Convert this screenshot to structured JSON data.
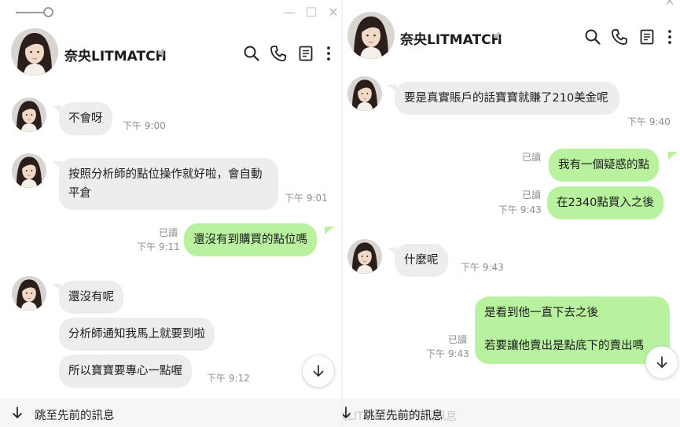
{
  "left": {
    "contact_name": "奈央LITMATCH",
    "messages": [
      {
        "text": "不會呀",
        "time": "下午 9:00"
      },
      {
        "text": "按照分析師的點位操作就好啦，會自動平倉",
        "time": "下午 9:01"
      },
      {
        "text": "還沒有到購買的點位嗎",
        "read": "已讀",
        "time": "下午 9:11"
      },
      {
        "text": "還沒有呢"
      },
      {
        "text": "分析師通知我馬上就要到啦"
      },
      {
        "text": "所以寶寶要專心一點喔",
        "time": "下午 9:12"
      }
    ],
    "jump_label": "跳至先前的訊息"
  },
  "right": {
    "contact_name": "奈央LITMATCH",
    "messages": [
      {
        "text": "要是真實賬戶的話寶寶就賺了210美金呢",
        "time": "下午 9:40"
      },
      {
        "text": "我有一個疑惑的點",
        "read": "已讀"
      },
      {
        "text": "在2340點買入之後",
        "read": "已讀",
        "time": "下午 9:43"
      },
      {
        "text": "什麼呢",
        "time": "下午 9:43"
      },
      {
        "line1": "是看到他一直下去之後",
        "line2": "若要讓他賣出是點底下的賣出嗎",
        "read": "已讀",
        "time": "下午 9:43"
      }
    ],
    "jump_label": "跳至先前的訊息",
    "ghost_text": "央LITMATCH已收回訊息"
  },
  "icons": {
    "search": "search-icon",
    "call": "phone-icon",
    "notes": "notes-icon",
    "more": "more-vertical-icon",
    "mute": "speaker-muted-icon",
    "scroll_down": "arrow-down-icon",
    "jump": "arrow-down-icon"
  },
  "colors": {
    "incoming_bubble": "#ededed",
    "outgoing_bubble": "#b9f29f",
    "timestamp": "#8e8e8e"
  }
}
